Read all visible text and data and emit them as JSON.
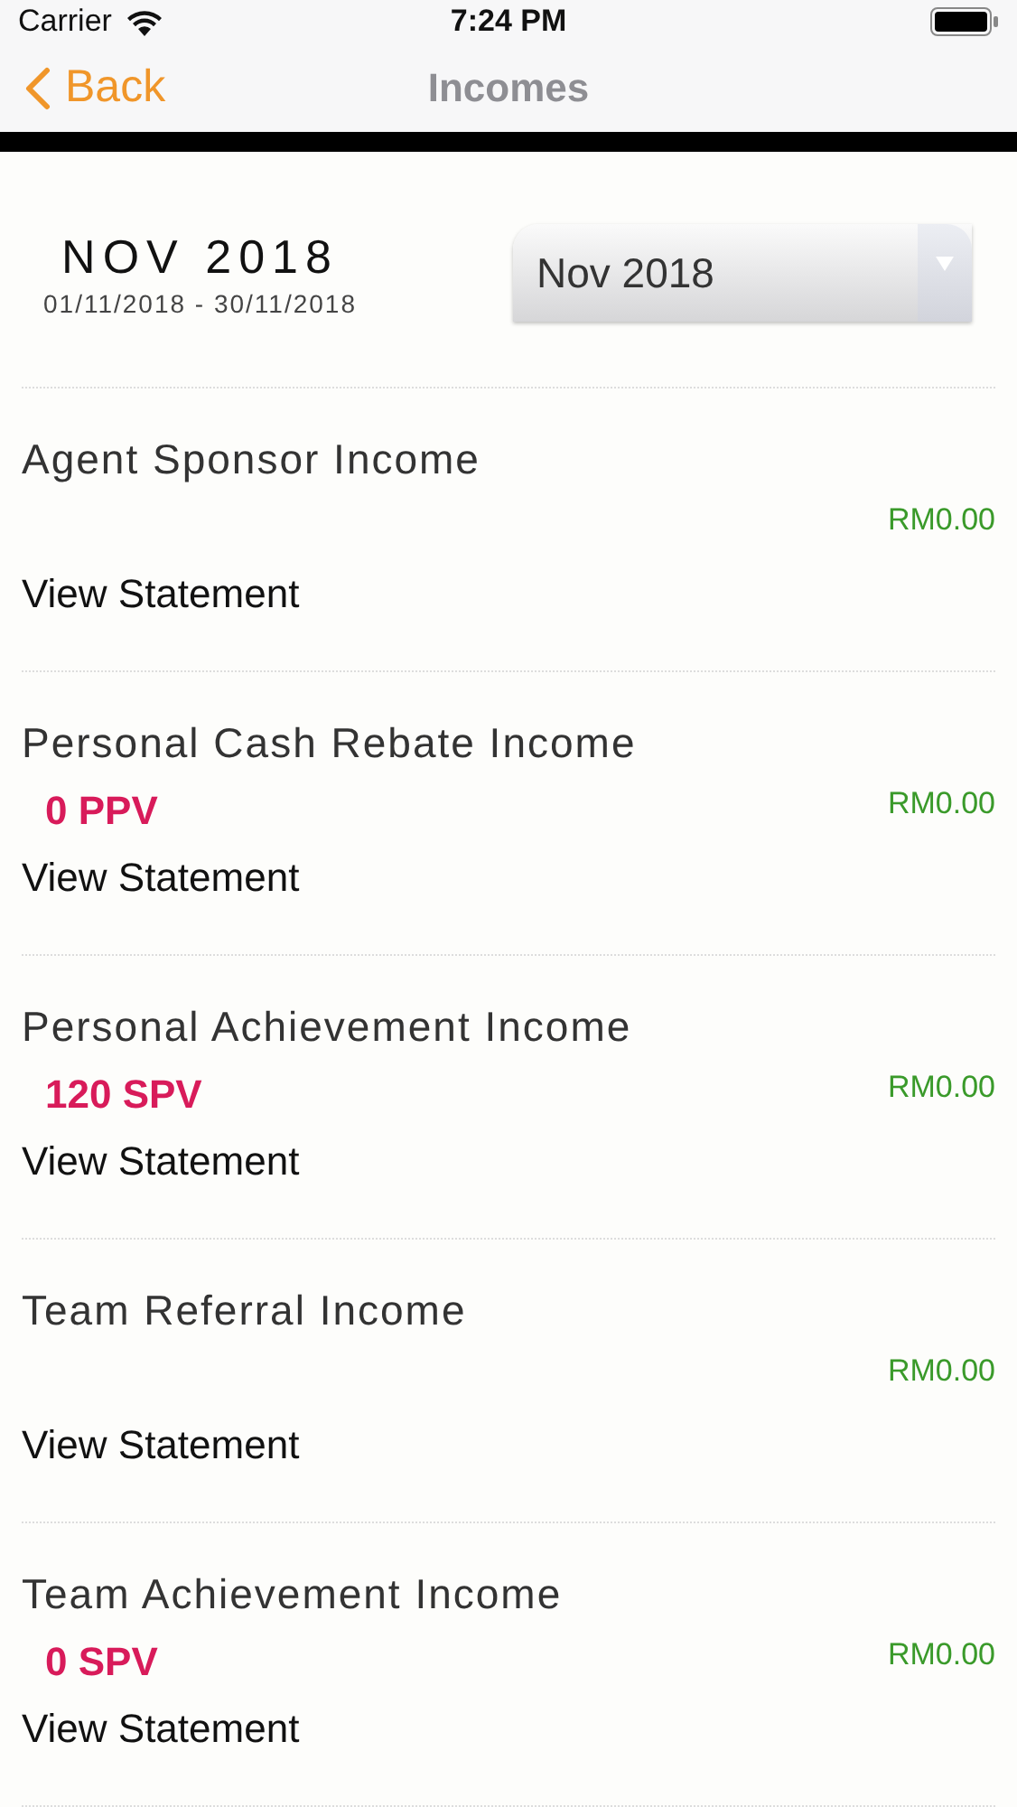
{
  "status_bar": {
    "carrier": "Carrier",
    "time": "7:24 PM"
  },
  "nav": {
    "back": "Back",
    "title": "Incomes"
  },
  "period": {
    "month": "NOV 2018",
    "range": "01/11/2018 - 30/11/2018",
    "dropdown_value": "Nov 2018"
  },
  "incomes": [
    {
      "title": "Agent Sponsor Income",
      "amount": "RM0.00",
      "link": "View Statement"
    },
    {
      "title": "Personal Cash Rebate Income",
      "points": "0 PPV",
      "amount": "RM0.00",
      "link": "View Statement"
    },
    {
      "title": "Personal Achievement Income",
      "points": "120 SPV",
      "amount": "RM0.00",
      "link": "View Statement"
    },
    {
      "title": "Team Referral Income",
      "amount": "RM0.00",
      "link": "View Statement"
    },
    {
      "title": "Team Achievement Income",
      "points": "0 SPV",
      "amount": "RM0.00",
      "link": "View Statement"
    }
  ]
}
